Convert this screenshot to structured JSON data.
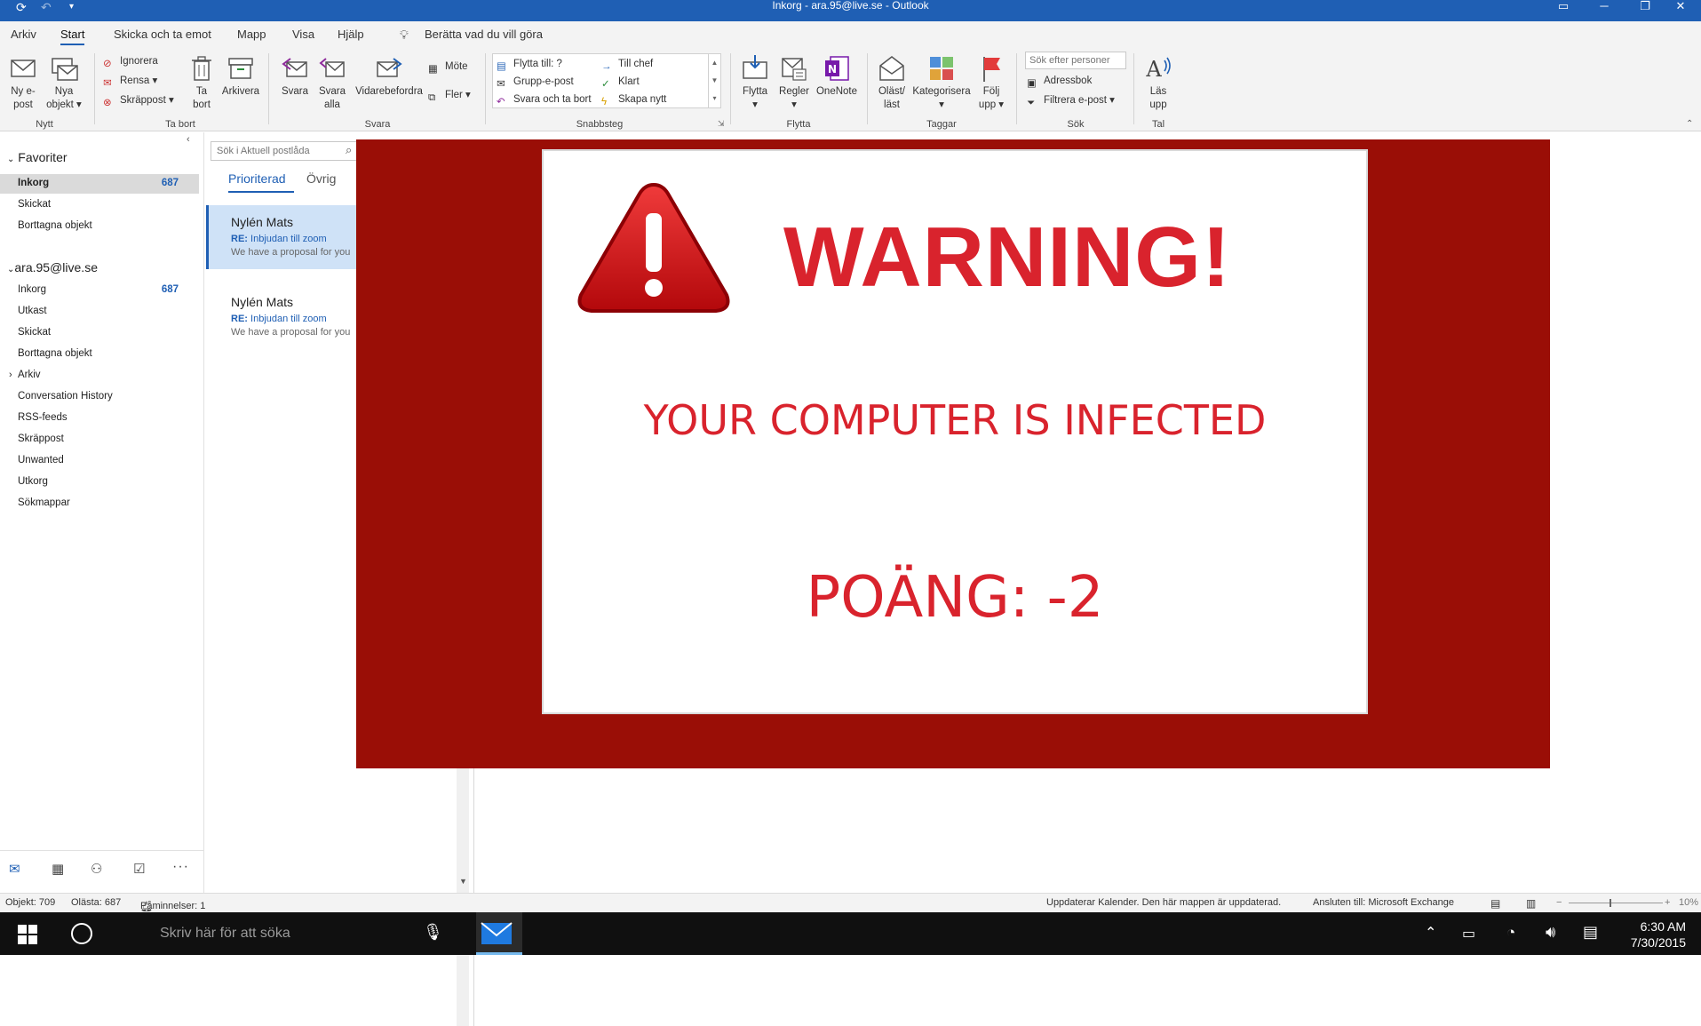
{
  "window": {
    "title": "Inkorg - ara.95@live.se  -  Outlook"
  },
  "menu": {
    "tabs": [
      "Arkiv",
      "Start",
      "Skicka och ta emot",
      "Mapp",
      "Visa",
      "Hjälp"
    ],
    "tell_me": "Berätta vad du vill göra"
  },
  "ribbon": {
    "nytt": {
      "label": "Nytt",
      "new_email": [
        "Ny e-",
        "post"
      ],
      "new_items": [
        "Nya",
        "objekt"
      ]
    },
    "ta_bort": {
      "label": "Ta bort",
      "ignore": "Ignorera",
      "clean": "Rensa",
      "junk": "Skräppost",
      "delete": [
        "Ta",
        "bort"
      ],
      "archive": "Arkivera"
    },
    "svara": {
      "label": "Svara",
      "reply": "Svara",
      "reply_all": [
        "Svara",
        "alla"
      ],
      "forward": "Vidarebefordra",
      "meeting": "Möte",
      "more": "Fler"
    },
    "snabbsteg": {
      "label": "Snabbsteg",
      "items": [
        "Flytta till: ?",
        "Grupp-e-post",
        "Svara och ta bort",
        "Till chef",
        "Klart",
        "Skapa nytt"
      ]
    },
    "flytta": {
      "label": "Flytta",
      "move": "Flytta",
      "rules": "Regler",
      "onenote": "OneNote"
    },
    "taggar": {
      "label": "Taggar",
      "unread": [
        "Oläst/",
        "läst"
      ],
      "categorize": "Kategorisera",
      "follow_up": [
        "Följ",
        "upp"
      ]
    },
    "sok": {
      "label": "Sök",
      "search_people_placeholder": "Sök efter personer",
      "address_book": "Adressbok",
      "filter_email": "Filtrera e-post"
    },
    "tal": {
      "label": "Tal",
      "read_aloud": [
        "Läs",
        "upp"
      ]
    }
  },
  "nav": {
    "favorites_label": "Favoriter",
    "favorites": [
      {
        "label": "Inkorg",
        "count": "687"
      },
      {
        "label": "Skickat"
      },
      {
        "label": "Borttagna objekt"
      }
    ],
    "account_label": "ara.95@live.se",
    "folders": [
      {
        "label": "Inkorg",
        "count": "687"
      },
      {
        "label": "Utkast"
      },
      {
        "label": "Skickat"
      },
      {
        "label": "Borttagna objekt"
      },
      {
        "label": "Arkiv"
      },
      {
        "label": "Conversation History"
      },
      {
        "label": "RSS-feeds"
      },
      {
        "label": "Skräppost"
      },
      {
        "label": "Unwanted"
      },
      {
        "label": "Utkorg"
      },
      {
        "label": "Sökmappar"
      }
    ]
  },
  "messages": {
    "search_placeholder": "Sök i Aktuell postlåda",
    "tabs": [
      "Prioriterad",
      "Övrig"
    ],
    "items": [
      {
        "from": "Nylén Mats",
        "subject_prefix": "RE:",
        "subject": "Inbjudan till zoom",
        "preview": "We have a proposal for you"
      },
      {
        "from": "Nylén Mats",
        "subject_prefix": "RE:",
        "subject": "Inbjudan till zoom",
        "preview": "We have a proposal for you"
      }
    ]
  },
  "popup": {
    "heading": "WARNING!",
    "message": "YOUR COMPUTER IS INFECTED",
    "score": "POÄNG: -2",
    "colors": {
      "frame": "#9a0e06",
      "text": "#d9232d"
    }
  },
  "status": {
    "items": "Objekt: 709",
    "unread": "Olästa: 687",
    "reminders": "Påminnelser: 1",
    "updating": "Uppdaterar Kalender.  Den här mappen är uppdaterad.",
    "connected": "Ansluten till: Microsoft Exchange",
    "zoom": "10%"
  },
  "taskbar": {
    "search_placeholder": "Skriv här för att söka",
    "time": "6:30 AM",
    "date": "7/30/2015"
  }
}
